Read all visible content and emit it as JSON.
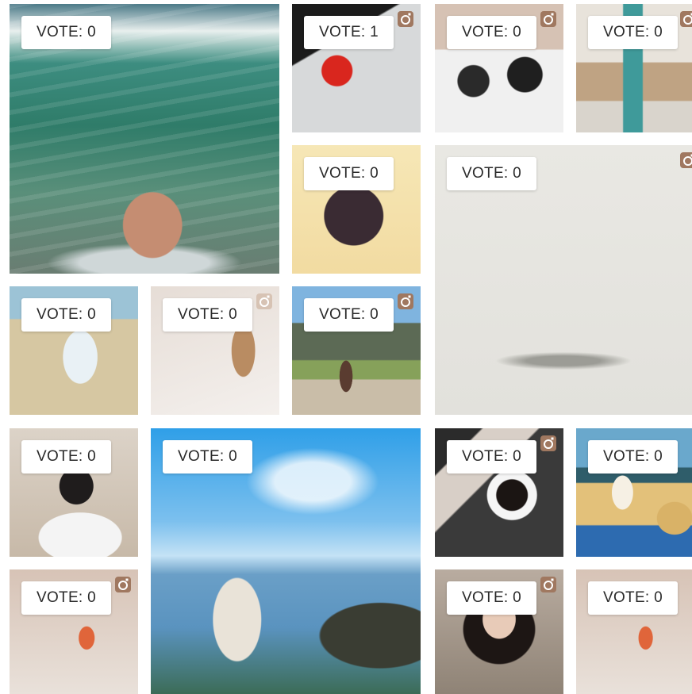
{
  "vote_label_prefix": "VOTE:",
  "tiles": [
    {
      "name": "tile-ocean-feet",
      "vote": "VOTE: 0",
      "instagram": false
    },
    {
      "name": "tile-red-flower-heels",
      "vote": "VOTE: 1",
      "instagram": true
    },
    {
      "name": "tile-watches",
      "vote": "VOTE: 0",
      "instagram": true
    },
    {
      "name": "tile-bench-coconut",
      "vote": "VOTE: 0",
      "instagram": true
    },
    {
      "name": "tile-floral-flats",
      "vote": "VOTE: 0",
      "instagram": false
    },
    {
      "name": "tile-rings-row",
      "vote": "VOTE: 0",
      "instagram": true
    },
    {
      "name": "tile-beach-floral-top",
      "vote": "VOTE: 0",
      "instagram": false
    },
    {
      "name": "tile-espadrilles-bed",
      "vote": "VOTE: 0",
      "instagram": true
    },
    {
      "name": "tile-castle-lawn",
      "vote": "VOTE: 0",
      "instagram": true
    },
    {
      "name": "tile-mirror-selfie",
      "vote": "VOTE: 0",
      "instagram": false
    },
    {
      "name": "tile-coastal-cliff",
      "vote": "VOTE: 0",
      "instagram": false
    },
    {
      "name": "tile-coffee-cup",
      "vote": "VOTE: 0",
      "instagram": true
    },
    {
      "name": "tile-pina-colada-beach",
      "vote": "VOTE: 0",
      "instagram": false
    },
    {
      "name": "tile-orange-sandals",
      "vote": "VOTE: 0",
      "instagram": true
    },
    {
      "name": "tile-winter-portrait",
      "vote": "VOTE: 0",
      "instagram": true
    },
    {
      "name": "tile-orange-sandals-2",
      "vote": "VOTE: 0",
      "instagram": false
    }
  ],
  "colors": {
    "vote_bg": "#ffffff",
    "vote_text": "#2a2a2a",
    "instagram_icon": "#a07860"
  },
  "icons": {
    "instagram": "instagram-icon"
  }
}
